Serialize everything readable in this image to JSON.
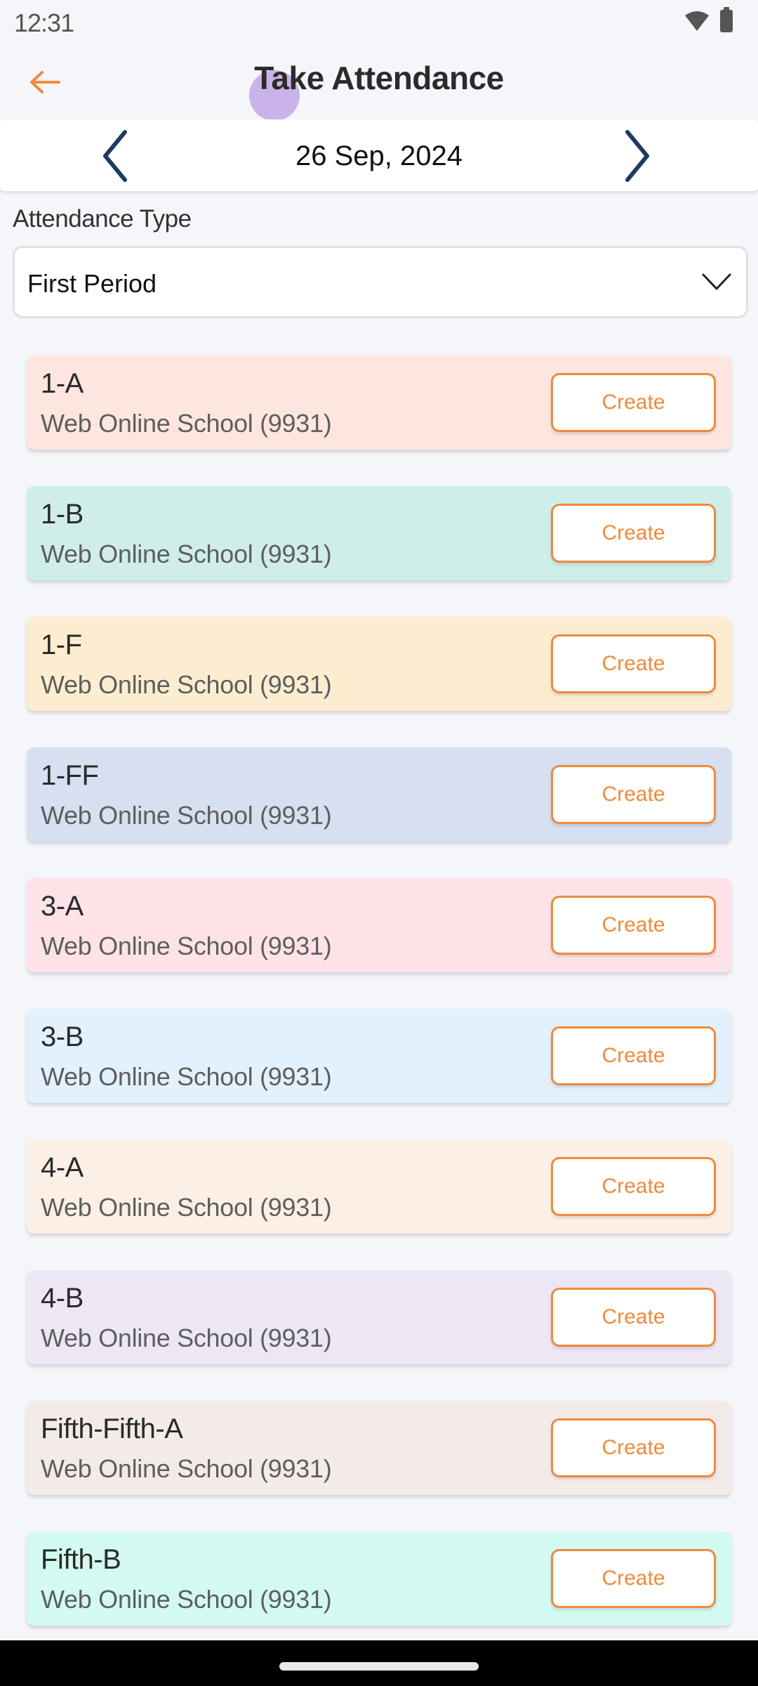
{
  "status_bar": {
    "time": "12:31",
    "icons": [
      "wifi-icon",
      "battery-icon"
    ]
  },
  "header": {
    "title": "Take Attendance",
    "back_icon": "arrow-left-icon",
    "accent_color": "#ef8a3c"
  },
  "date_nav": {
    "date": "26 Sep, 2024",
    "prev_icon": "chevron-left-icon",
    "next_icon": "chevron-right-icon",
    "icon_color": "#1f3a63"
  },
  "attendance_type": {
    "label": "Attendance Type",
    "selected": "First Period",
    "icon": "chevron-down-icon"
  },
  "classes": [
    {
      "name": "1-A",
      "school": "Web Online School (9931)",
      "action": "Create",
      "color": "#fde6df"
    },
    {
      "name": "1-B",
      "school": "Web Online School (9931)",
      "action": "Create",
      "color": "#cfeeea"
    },
    {
      "name": "1-F",
      "school": "Web Online School (9931)",
      "action": "Create",
      "color": "#fcedd1"
    },
    {
      "name": "1-FF",
      "school": "Web Online School (9931)",
      "action": "Create",
      "color": "#d6e0f0"
    },
    {
      "name": "3-A",
      "school": "Web Online School (9931)",
      "action": "Create",
      "color": "#fde3e7"
    },
    {
      "name": "3-B",
      "school": "Web Online School (9931)",
      "action": "Create",
      "color": "#e3f1fc"
    },
    {
      "name": "4-A",
      "school": "Web Online School (9931)",
      "action": "Create",
      "color": "#fcf0e6"
    },
    {
      "name": "4-B",
      "school": "Web Online School (9931)",
      "action": "Create",
      "color": "#ede6f5"
    },
    {
      "name": "Fifth-Fifth-A",
      "school": "Web Online School (9931)",
      "action": "Create",
      "color": "#f3ebe8"
    },
    {
      "name": "Fifth-B",
      "school": "Web Online School (9931)",
      "action": "Create",
      "color": "#d3faf1"
    }
  ]
}
